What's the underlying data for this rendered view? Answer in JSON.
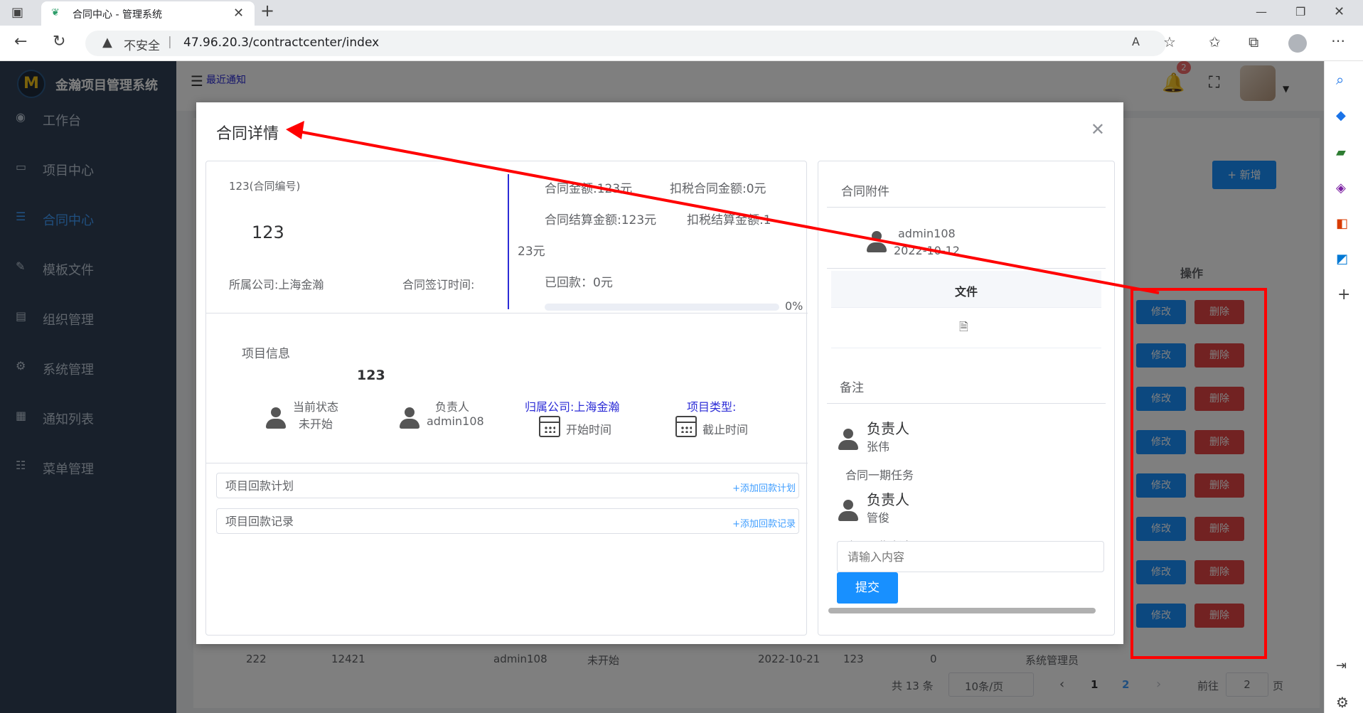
{
  "browser": {
    "tab_title": "合同中心 - 管理系统",
    "insecure_label": "不安全",
    "url": "47.96.20.3/contractcenter/index",
    "icons": [
      "sidebar-toggle-icon",
      "leaf-icon",
      "close-icon",
      "plus-icon",
      "back-icon",
      "reload-icon",
      "warning-icon",
      "read-aloud-icon",
      "favorite-add-icon",
      "favorites-icon",
      "collections-icon",
      "profile-icon",
      "more-icon",
      "minimize-icon",
      "restore-icon",
      "close-window-icon"
    ]
  },
  "app": {
    "logo_letter": "M",
    "title": "金瀚项目管理系统",
    "recent_notice": "最近通知",
    "notification_count": "2",
    "sidebar": {
      "items": [
        {
          "label": "工作台",
          "icon": "dashboard-icon"
        },
        {
          "label": "项目中心",
          "icon": "monitor-icon"
        },
        {
          "label": "合同中心",
          "icon": "list-icon"
        },
        {
          "label": "模板文件",
          "icon": "edit-icon"
        },
        {
          "label": "组织管理",
          "icon": "org-icon"
        },
        {
          "label": "系统管理",
          "icon": "settings-icon"
        },
        {
          "label": "通知列表",
          "icon": "document-icon"
        },
        {
          "label": "菜单管理",
          "icon": "menu-icon"
        }
      ]
    },
    "add_button": "+ 新增",
    "ops_header": "操作",
    "edit_label": "修改",
    "delete_label": "删除",
    "bottom_row": [
      "222",
      "12421",
      "admin108",
      "未开始",
      "2022-10-21",
      "123",
      "0",
      "系统管理员"
    ],
    "pagination": {
      "total": "共 13 条",
      "page_size": "10条/页",
      "pages": [
        "1",
        "2"
      ],
      "goto_label": "前往",
      "goto_value": "2",
      "page_suffix": "页"
    }
  },
  "dialog": {
    "title": "合同详情",
    "contract_number_label": "123(合同编号)",
    "contract_number": "123",
    "company": "所属公司:上海金瀚",
    "sign_time": "合同签订时间:",
    "amount": "合同金额:123元",
    "tax_amount": "扣税合同金额:0元",
    "settle_amount": "合同结算金额:123元",
    "tax_settle_amount_a": "扣税结算金额:1",
    "tax_settle_amount_b": "23元",
    "received": "已回款：0元",
    "progress_percent": 0,
    "progress_label": "0%",
    "project_info_label": "项目信息",
    "project_name": "123",
    "current_status_label": "当前状态",
    "current_status": "未开始",
    "owner_label": "负责人",
    "owner": "admin108",
    "owner_company": "归属公司:上海金瀚",
    "project_type": "项目类型:",
    "start_time": "开始时间",
    "end_time": "截止时间",
    "payment_plan": "项目回款计划",
    "add_payment_plan": "+添加回款计划",
    "payment_record": "项目回款记录",
    "add_payment_record": "+添加回款记录",
    "attachments_label": "合同附件",
    "attachment_user": "admin108",
    "attachment_date": "2022-10-12",
    "file_header": "文件",
    "remarks_label": "备注",
    "remarks": [
      {
        "role": "负责人",
        "name": "张伟",
        "text": "合同一期任务"
      },
      {
        "role": "负责人",
        "name": "管俊",
        "text": "合同一期任务"
      }
    ],
    "input_placeholder": "请输入内容",
    "submit_label": "提交"
  },
  "colors": {
    "sidebar_bg": "#304156",
    "active": "#409eff",
    "primary": "#1890ff",
    "danger": "#e54545",
    "annotation": "#ff0000"
  }
}
